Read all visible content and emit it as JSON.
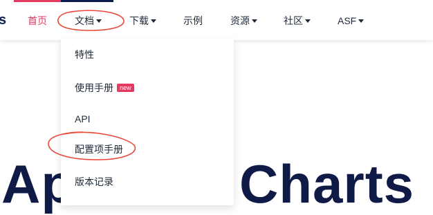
{
  "brand": {
    "logo_fragment": "s"
  },
  "nav": {
    "home": "首页",
    "docs": "文档",
    "download": "下载",
    "examples": "示例",
    "resources": "资源",
    "community": "社区",
    "asf": "ASF"
  },
  "docs_menu": {
    "items": [
      {
        "label": "特性"
      },
      {
        "label": "使用手册",
        "badge": "new"
      },
      {
        "label": "API"
      },
      {
        "label": "配置项手册"
      },
      {
        "label": "版本记录"
      }
    ]
  },
  "hero": {
    "title_left": "Ap",
    "title_right": "Charts"
  },
  "colors": {
    "accent": "#e43961",
    "navy": "#0b1c4e",
    "annotation": "#e8493a",
    "text": "#1e2a3a"
  }
}
